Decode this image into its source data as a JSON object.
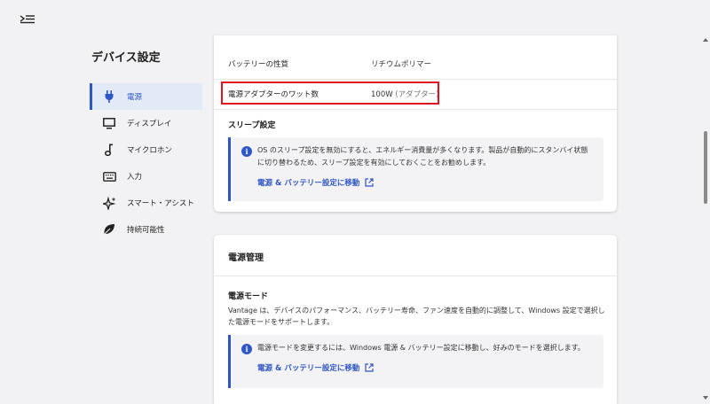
{
  "sidebar": {
    "title": "デバイス設定",
    "items": [
      {
        "label": "電源",
        "icon": "plug-icon",
        "active": true
      },
      {
        "label": "ディスプレイ",
        "icon": "monitor-icon"
      },
      {
        "label": "マイクロホン",
        "icon": "music-note-icon"
      },
      {
        "label": "入力",
        "icon": "keyboard-icon"
      },
      {
        "label": "スマート・アシスト",
        "icon": "sparkle-icon"
      },
      {
        "label": "持続可能性",
        "icon": "leaf-icon"
      }
    ]
  },
  "battery_card": {
    "rows": [
      {
        "key": "バッテリーの性質",
        "value": "リチウムポリマー"
      },
      {
        "key": "電源アダプターのワット数",
        "value": "100W",
        "value_sub": "(アダプター)"
      }
    ],
    "sleep_title": "スリープ設定",
    "sleep_info": "OS のスリープ設定を無効にすると、エネルギー消費量が多くなります。製品が自動的にスタンバイ状態に切り替わるため、スリープ設定を有効にしておくことをお勧めします。",
    "sleep_link": "電源 & バッテリー設定に移動"
  },
  "power_card": {
    "title": "電源管理",
    "mode_title": "電源モード",
    "mode_desc": "Vantage は、デバイスのパフォーマンス、バッテリー寿命、ファン速度を自動的に調整して、Windows 設定で選択した電源モードをサポートします。",
    "mode_info": "電源モードを変更するには、Windows 電源 & バッテリー設定に移動し、好みのモードを選択します。",
    "mode_link": "電源 & バッテリー設定に移動"
  },
  "colors": {
    "accent": "#2f56c6",
    "highlight": "#e0141e"
  }
}
